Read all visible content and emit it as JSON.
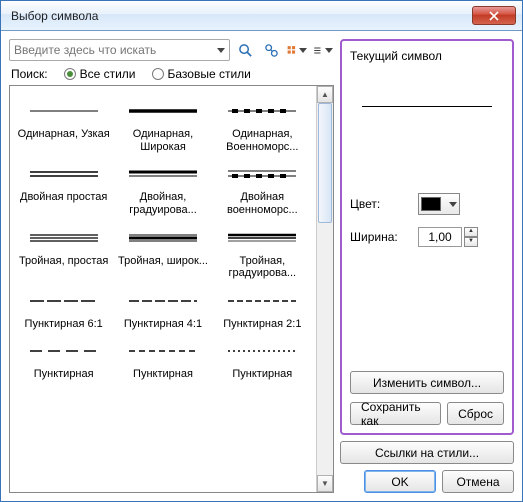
{
  "title": "Выбор символа",
  "search": {
    "placeholder": "Введите здесь что искать"
  },
  "searchLabel": "Поиск:",
  "radios": {
    "all": "Все стили",
    "base": "Базовые стили"
  },
  "symbols": [
    {
      "label": "Одинарная, Узкая",
      "style": "single-thin"
    },
    {
      "label": "Одинарная, Широкая",
      "style": "single-thick"
    },
    {
      "label": "Одинарная, Военноморс...",
      "style": "single-navy"
    },
    {
      "label": "Двойная простая",
      "style": "double-plain"
    },
    {
      "label": "Двойная, градуирова...",
      "style": "double-grad"
    },
    {
      "label": "Двойная военноморс...",
      "style": "double-navy"
    },
    {
      "label": "Тройная, простая",
      "style": "triple-plain"
    },
    {
      "label": "Тройная, широк...",
      "style": "triple-wide"
    },
    {
      "label": "Тройная, градуирова...",
      "style": "triple-grad"
    },
    {
      "label": "Пунктирная 6:1",
      "style": "dash-61"
    },
    {
      "label": "Пунктирная 4:1",
      "style": "dash-41"
    },
    {
      "label": "Пунктирная 2:1",
      "style": "dash-21"
    },
    {
      "label": "Пунктирная",
      "style": "dash-a"
    },
    {
      "label": "Пунктирная",
      "style": "dash-b"
    },
    {
      "label": "Пунктирная",
      "style": "dash-c"
    }
  ],
  "current": {
    "title": "Текущий символ",
    "colorLabel": "Цвет:",
    "colorValue": "#000000",
    "widthLabel": "Ширина:",
    "widthValue": "1,00",
    "editBtn": "Изменить символ...",
    "saveBtn": "Сохранить как",
    "resetBtn": "Сброс"
  },
  "linksBtn": "Ссылки на стили...",
  "okBtn": "OK",
  "cancelBtn": "Отмена"
}
